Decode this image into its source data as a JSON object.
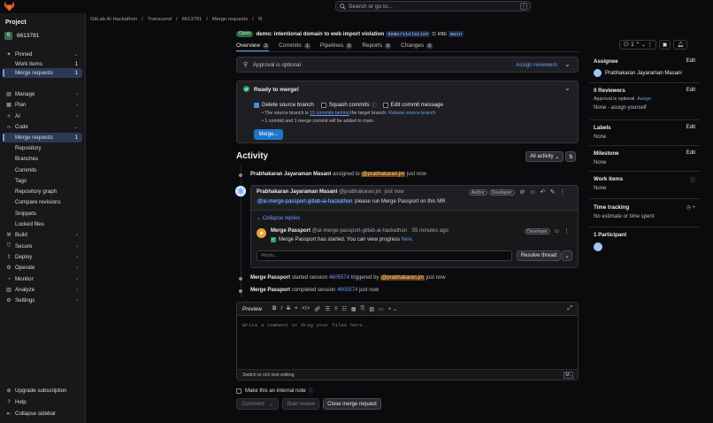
{
  "search": {
    "placeholder": "Search or go to...",
    "shortcut": "/"
  },
  "sidebar": {
    "heading": "Project",
    "project": {
      "initial": "6",
      "name": "6613781"
    },
    "items": [
      {
        "label": "Pinned",
        "icon": "pin-icon",
        "chevron": "⌄"
      },
      {
        "label": "Work items",
        "count": "1",
        "sub": true
      },
      {
        "label": "Merge requests",
        "count": "1",
        "sub": true,
        "active": true
      },
      {
        "label": "Manage",
        "icon": "manage-icon",
        "chevron": "›"
      },
      {
        "label": "Plan",
        "icon": "plan-icon",
        "chevron": "›"
      },
      {
        "label": "AI",
        "icon": "ai-icon",
        "chevron": "›"
      },
      {
        "label": "Code",
        "icon": "code-icon",
        "chevron": "⌄"
      },
      {
        "label": "Merge requests",
        "count": "1",
        "sub": true,
        "active": true
      },
      {
        "label": "Repository",
        "sub": true
      },
      {
        "label": "Branches",
        "sub": true
      },
      {
        "label": "Commits",
        "sub": true
      },
      {
        "label": "Tags",
        "sub": true
      },
      {
        "label": "Repository graph",
        "sub": true
      },
      {
        "label": "Compare revisions",
        "sub": true
      },
      {
        "label": "Snippets",
        "sub": true
      },
      {
        "label": "Locked files",
        "sub": true
      },
      {
        "label": "Build",
        "icon": "build-icon",
        "chevron": "›"
      },
      {
        "label": "Secure",
        "icon": "shield-icon",
        "chevron": "›"
      },
      {
        "label": "Deploy",
        "icon": "deploy-icon",
        "chevron": "›"
      },
      {
        "label": "Operate",
        "icon": "operate-icon",
        "chevron": "›"
      },
      {
        "label": "Monitor",
        "icon": "monitor-icon",
        "chevron": "›"
      },
      {
        "label": "Analyze",
        "icon": "analyze-icon",
        "chevron": "›"
      },
      {
        "label": "Settings",
        "icon": "gear-icon",
        "chevron": "›"
      }
    ],
    "footer": [
      {
        "label": "Upgrade subscription",
        "icon": "upgrade-icon"
      },
      {
        "label": "Help",
        "icon": "help-icon"
      },
      {
        "label": "Collapse sidebar",
        "icon": "collapse-icon"
      }
    ]
  },
  "breadcrumb": [
    "GitLab AI Hackathon",
    "/",
    "Transcend",
    "/",
    "6613781",
    "/",
    "Merge requests",
    "/",
    "!6"
  ],
  "mr": {
    "status": "Open",
    "title": "demo: intentional domain to web import violation",
    "source_branch": "demo/violation",
    "into_label": "into",
    "target_branch": "main"
  },
  "tabs": [
    {
      "label": "Overview",
      "count": "2",
      "active": true
    },
    {
      "label": "Commits",
      "count": "1"
    },
    {
      "label": "Pipelines",
      "count": "0"
    },
    {
      "label": "Reports",
      "count": "0"
    },
    {
      "label": "Changes",
      "count": "0"
    }
  ],
  "toolbar": {
    "threads_count": "1"
  },
  "approval": {
    "text": "Approval is optional",
    "assign_label": "Assign reviewers"
  },
  "merge": {
    "status": "Ready to merge!",
    "delete_branch": "Delete source branch",
    "squash": "Squash commits",
    "edit_message": "Edit commit message",
    "info1_pre": "The source branch is",
    "info1_link": "15 commits behind",
    "info1_mid": "the target branch.",
    "info1_link2": "Rebase source branch",
    "info2": "1 commit and 1 merge commit will be added to main.",
    "button": "Merge..."
  },
  "activity": {
    "title": "Activity",
    "filter": "All activity",
    "events": [
      {
        "author": "Prabhakaran Jayaraman Masani",
        "text": "assigned to",
        "mention": "@prabhakaran.jm",
        "time": "just now"
      },
      {
        "author": "Merge Passport",
        "text": "started session",
        "link": "4605574",
        "text2": "triggered by",
        "mention": "@prabhakaran.jm",
        "time": "just now"
      },
      {
        "author": "Merge Passport",
        "text": "completed session",
        "link": "4605574",
        "time": "just now"
      }
    ],
    "comment": {
      "author": "Prabhakaran Jayaraman Masani",
      "handle": "@prabhakaran.jm",
      "time": "just now",
      "role1": "Author",
      "role2": "Developer",
      "mention": "@ai-merge-passport-gitlab-ai-hackathon",
      "body": "please run Merge Passport on this MR",
      "collapse": "Collapse replies",
      "reply_author": "Merge Passport",
      "reply_handle": "@ai-merge-passport-gitlab-ai-hackathon",
      "reply_time": "55 minutes ago",
      "reply_role": "Developer",
      "reply_body": "Merge Passport has started. You can view progress",
      "reply_link": "here.",
      "reply_placeholder": "Reply...",
      "resolve": "Resolve thread"
    }
  },
  "editor": {
    "tab": "Preview",
    "placeholder": "Write a comment or drag your files here...",
    "switch": "Switch to rich text editing",
    "internal_note": "Make this an internal note",
    "comment_btn": "Comment",
    "start_review": "Start review",
    "close_mr": "Close merge request"
  },
  "right": {
    "assignee": {
      "label": "Assignee",
      "edit": "Edit",
      "name": "Prabhakaran Jayaraman Masani"
    },
    "reviewers": {
      "label": "0 Reviewers",
      "edit": "Edit",
      "optional": "Approval is optional",
      "assign": "Assign",
      "none": "None - assign yourself"
    },
    "labels": {
      "label": "Labels",
      "edit": "Edit",
      "value": "None"
    },
    "milestone": {
      "label": "Milestone",
      "edit": "Edit",
      "value": "None"
    },
    "work_items": {
      "label": "Work items",
      "value": "None"
    },
    "time": {
      "label": "Time tracking",
      "value": "No estimate or time spent"
    },
    "participants": {
      "label": "1 Participant"
    }
  }
}
